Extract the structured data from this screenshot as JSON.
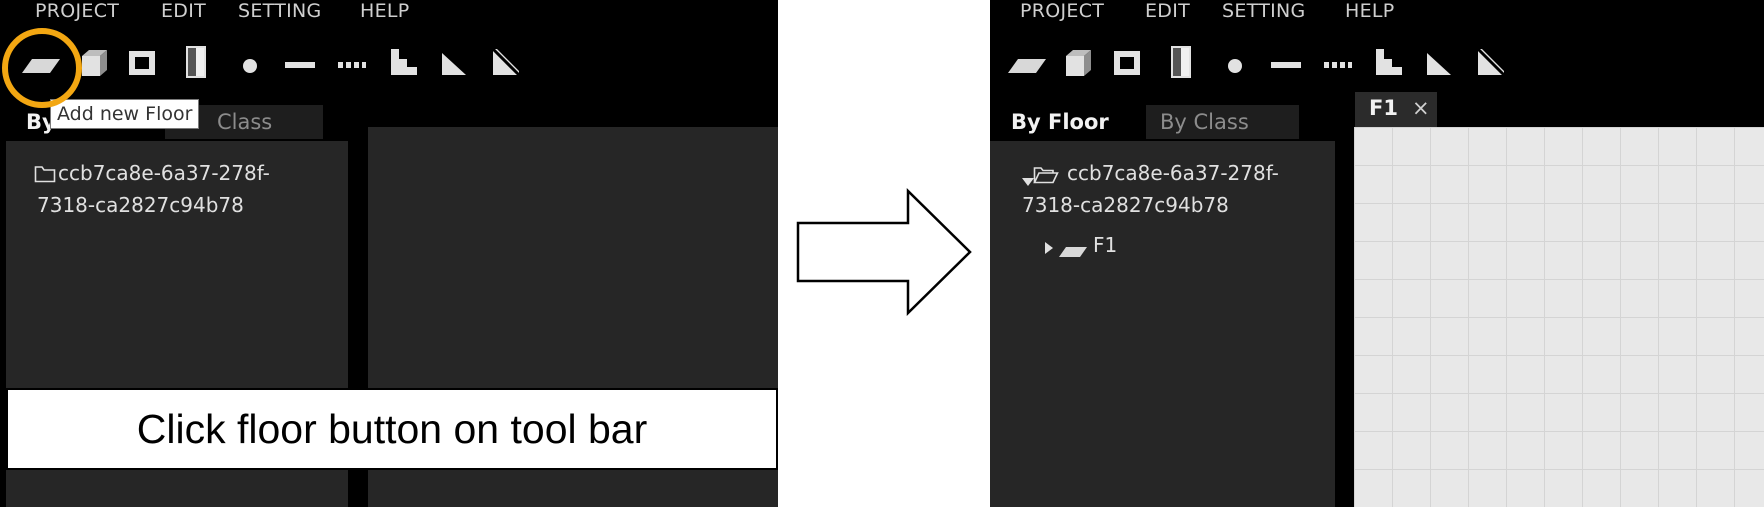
{
  "menu": [
    "PROJECT",
    "EDIT",
    "SETTING",
    "HELP"
  ],
  "toolbar_icons": [
    "floor-icon",
    "cell-cube-icon",
    "room-square-icon",
    "door-icon",
    "point-icon",
    "line-icon",
    "dashed-line-icon",
    "stairs-icon",
    "slope-icon",
    "hatched-square-icon"
  ],
  "sidebar_tabs": {
    "by_floor": "By Floor",
    "by_class": "By Class"
  },
  "left": {
    "tab_by_floor_visible": "By",
    "tab_by_class_visible": "Class",
    "tooltip": "Add new Floor",
    "project_id_line1": "ccb7ca8e-6a37-278f-",
    "project_id_line2": "7318-ca2827c94b78",
    "caption": "Click floor button on tool bar"
  },
  "right": {
    "project_id_line1": "ccb7ca8e-6a37-278f-",
    "project_id_line2": "7318-ca2827c94b78",
    "floor_item": "F1",
    "doc_tab_label": "F1",
    "doc_tab_close": "×"
  },
  "colors": {
    "highlight": "#f3a712",
    "background": "#000000",
    "pane": "#262626",
    "grid": "#e8e8e8"
  }
}
